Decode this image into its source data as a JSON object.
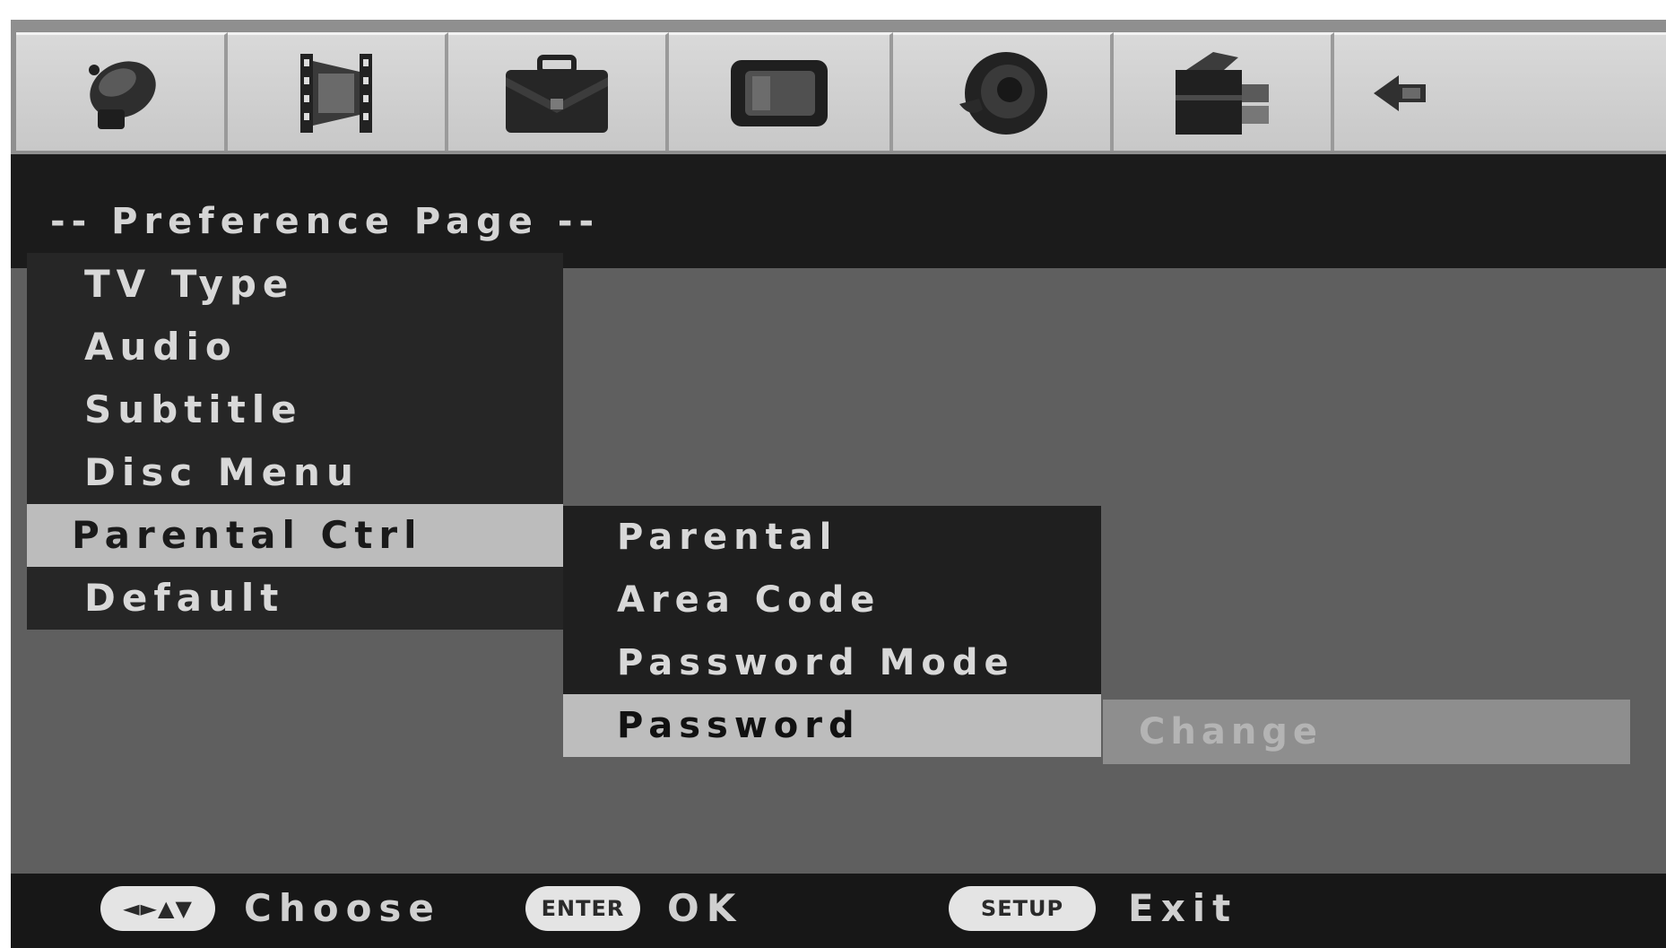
{
  "tabs": [
    {
      "icon": "satellite-dish-icon"
    },
    {
      "icon": "film-strip-icon"
    },
    {
      "icon": "briefcase-icon"
    },
    {
      "icon": "tv-screen-icon"
    },
    {
      "icon": "speaker-icon"
    },
    {
      "icon": "toolbox-icon"
    },
    {
      "icon": "arrow-left-icon"
    }
  ],
  "header": {
    "title": "-- Preference Page --"
  },
  "menu": {
    "items": [
      {
        "label": "TV Type"
      },
      {
        "label": "Audio"
      },
      {
        "label": "Subtitle"
      },
      {
        "label": "Disc Menu"
      },
      {
        "label": "Parental Ctrl",
        "selected": true
      },
      {
        "label": "Default"
      }
    ]
  },
  "submenu": {
    "items": [
      {
        "label": "Parental"
      },
      {
        "label": "Area Code"
      },
      {
        "label": "Password Mode"
      },
      {
        "label": "Password",
        "selected": true
      }
    ]
  },
  "option": {
    "value": "Change"
  },
  "footer": {
    "hints": [
      {
        "key": "◄►▲▼",
        "label": "Choose"
      },
      {
        "key": "ENTER",
        "label": "OK"
      },
      {
        "key": "SETUP",
        "label": "Exit"
      }
    ]
  },
  "colors": {
    "screen_bg": "#5f5f5f",
    "bar_bg": "#1b1b1b",
    "menu_bg": "#262626",
    "highlight": "#bcbcbc",
    "text": "#d8d8d8"
  }
}
